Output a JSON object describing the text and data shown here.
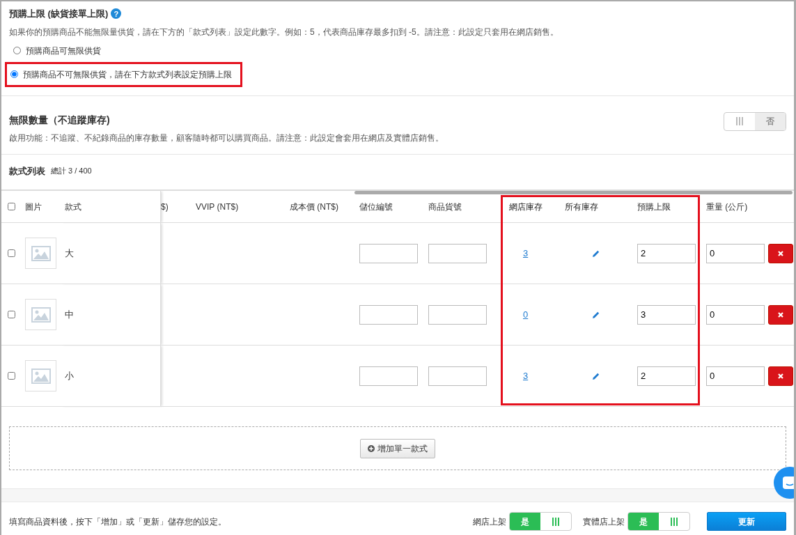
{
  "preorder_limit": {
    "title": "預購上限 (缺貨接單上限)",
    "help_label": "?",
    "description": "如果你的預購商品不能無限量供貨，請在下方的「款式列表」設定此數字。例如：5，代表商品庫存最多扣到 -5。請注意：此設定只套用在網店銷售。",
    "options": [
      {
        "label": "預購商品可無限供貨",
        "selected": false,
        "highlighted": false
      },
      {
        "label": "預購商品不可無限供貨，請在下方款式列表設定預購上限",
        "selected": true,
        "highlighted": true
      }
    ]
  },
  "unlimited_quantity": {
    "title": "無限數量（不追蹤庫存)",
    "description": "啟用功能：不追蹤、不紀錄商品的庫存數量，顧客隨時都可以購買商品。請注意：此設定會套用在網店及實體店銷售。",
    "toggle": {
      "on": false,
      "off_label": "否"
    }
  },
  "variants": {
    "title": "款式列表",
    "total": "總計 3 / 400",
    "all_selected": false,
    "columns": [
      {
        "label": "圖片",
        "highlighted": false
      },
      {
        "label": "款式",
        "highlighted": false
      },
      {
        "label": "$)",
        "highlighted": false
      },
      {
        "label": "VVIP (NT$)",
        "highlighted": false
      },
      {
        "label": "成本價 (NT$)",
        "highlighted": false
      },
      {
        "label": "儲位編號",
        "highlighted": false
      },
      {
        "label": "商品貨號",
        "highlighted": false
      },
      {
        "label": "網店庫存",
        "highlighted": true
      },
      {
        "label": "所有庫存",
        "highlighted": true
      },
      {
        "label": "預購上限",
        "highlighted": true
      },
      {
        "label": "重量 (公斤)",
        "highlighted": false
      }
    ],
    "rows": [
      {
        "selected": false,
        "name": "大",
        "store_stock": "3",
        "preorder_limit": "2",
        "weight": "0"
      },
      {
        "selected": false,
        "name": "中",
        "store_stock": "0",
        "preorder_limit": "3",
        "weight": "0"
      },
      {
        "selected": false,
        "name": "小",
        "store_stock": "3",
        "preorder_limit": "2",
        "weight": "0"
      }
    ],
    "add_button": "增加單一款式"
  },
  "footer": {
    "note": "填寫商品資料後，按下「增加」或「更新」儲存您的設定。",
    "toggles": [
      {
        "label": "網店上架",
        "on": true,
        "on_label": "是"
      },
      {
        "label": "實體店上架",
        "on": true,
        "on_label": "是"
      }
    ],
    "update_button": "更新"
  }
}
